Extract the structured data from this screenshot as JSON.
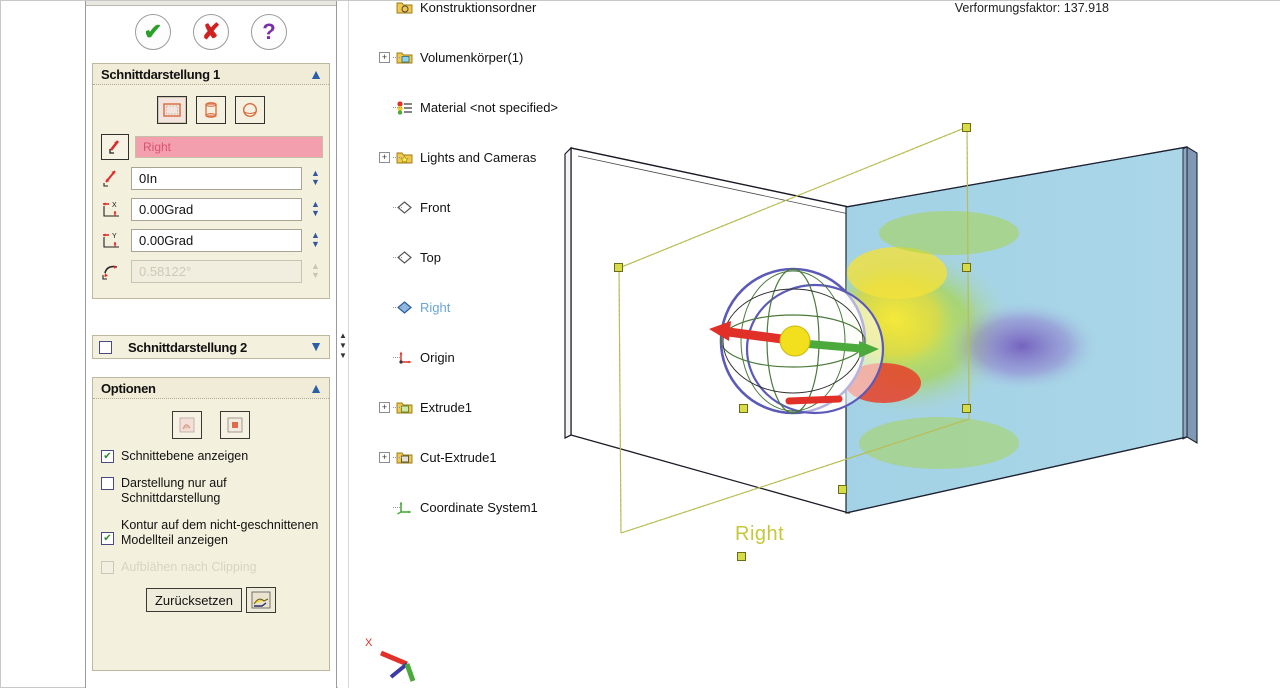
{
  "property_manager": {
    "confirm_bar": {
      "ok_label": "✔",
      "ok_name": "OK",
      "cancel_label": "✘",
      "cancel_name": "Abbrechen",
      "help_label": "?",
      "help_name": "Hilfe"
    },
    "section_group": {
      "title": "Schnittdarstellung 1",
      "collapse_chevron": "▲",
      "section_types": [
        {
          "name": "planar",
          "glyph": "▭",
          "selected": true
        },
        {
          "name": "cylindrical",
          "glyph": "⬭",
          "selected": false
        },
        {
          "name": "spherical",
          "glyph": "○",
          "selected": false
        }
      ],
      "reference_plane": {
        "value": "Right",
        "icon": "arrow-plane-icon"
      },
      "fields": [
        {
          "icon": "offset-distance-icon",
          "value": "0In",
          "disabled": false
        },
        {
          "icon": "rotate-x-icon",
          "value": "0.00Grad",
          "disabled": false
        },
        {
          "icon": "rotate-y-icon",
          "value": "0.00Grad",
          "disabled": false
        },
        {
          "icon": "rotate-z-icon",
          "value": "0.58122°",
          "disabled": true
        }
      ]
    },
    "section2_group": {
      "title": "Schnittdarstellung 2",
      "checked": false,
      "collapse_chevron": "▼"
    },
    "options_group": {
      "title": "Optionen",
      "collapse_chevron": "▲",
      "icon_buttons": [
        {
          "name": "section-color-icon",
          "glyph": "▧"
        },
        {
          "name": "section-hatch-icon",
          "glyph": "▦"
        }
      ],
      "checkboxes": [
        {
          "label": "Schnittebene anzeigen",
          "checked": true,
          "disabled": false
        },
        {
          "label": "Darstellung nur auf Schnittdarstellung",
          "checked": false,
          "disabled": false
        },
        {
          "label": "Kontur auf dem nicht-geschnittenen Modellteil anzeigen",
          "checked": true,
          "disabled": false
        },
        {
          "label": "Aufblähen nach Clipping",
          "checked": false,
          "disabled": true
        }
      ],
      "reset_button": "Zurücksetzen",
      "reset_icon": "reset-view-icon"
    }
  },
  "splitter": {
    "up_arrow": "▲",
    "down_arrow": "▼"
  },
  "feature_tree": {
    "items": [
      {
        "label": "Konstruktionsordner",
        "icon": "folder-icon",
        "expander": "",
        "selected": false,
        "clipped": true
      },
      {
        "label": "Volumenkörper(1)",
        "icon": "solid-bodies-icon",
        "expander": "+",
        "selected": false
      },
      {
        "label": "Material <not specified>",
        "icon": "material-icon",
        "expander": "",
        "selected": false
      },
      {
        "label": "Lights and Cameras",
        "icon": "lights-cameras-icon",
        "expander": "+",
        "selected": false
      },
      {
        "label": "Front",
        "icon": "plane-icon",
        "expander": "",
        "selected": false
      },
      {
        "label": "Top",
        "icon": "plane-icon",
        "expander": "",
        "selected": false
      },
      {
        "label": "Right",
        "icon": "plane-icon",
        "expander": "",
        "selected": true
      },
      {
        "label": "Origin",
        "icon": "origin-icon",
        "expander": "",
        "selected": false
      },
      {
        "label": "Extrude1",
        "icon": "extrude-icon",
        "expander": "+",
        "selected": false
      },
      {
        "label": "Cut-Extrude1",
        "icon": "cut-extrude-icon",
        "expander": "+",
        "selected": false
      },
      {
        "label": "Coordinate System1",
        "icon": "coordinate-system-icon",
        "expander": "",
        "selected": false
      }
    ]
  },
  "viewport": {
    "deformation_text": "Verformungsfaktor: 137.918",
    "plane_label": "Right",
    "triad_axis_label": "X",
    "colors": {
      "plate_fill": "#a8d4e6",
      "plate_edge": "#2b2b3a",
      "plane_outline": "#b9bd55",
      "handle_fill": "#d8dc46",
      "contour_green": "#a8d44a",
      "contour_yellow": "#f2e13c",
      "contour_purple": "#7e5fc0",
      "contour_red": "#e8402a",
      "triad_center": "#f2e01e",
      "triad_x": "#e03028",
      "triad_y": "#4caa3c",
      "triad_sphere": "#5c5ab8"
    }
  }
}
